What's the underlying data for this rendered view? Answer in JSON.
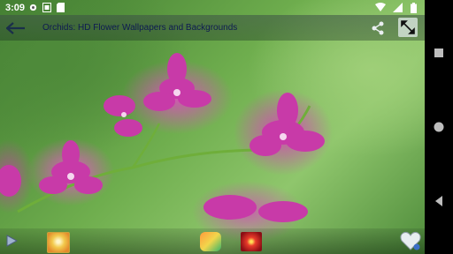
{
  "status_bar": {
    "time": "3:09",
    "left_icons": [
      "gear-icon",
      "photo-icon",
      "sd-card-icon"
    ],
    "right_icons": [
      "wifi-icon",
      "signal-icon",
      "battery-icon"
    ]
  },
  "app_bar": {
    "title": "Orchids: HD Flower Wallpapers and Backgrounds",
    "title_color": "#0e1a52",
    "actions": [
      "share-icon",
      "fullscreen-icon"
    ]
  },
  "wallpaper": {
    "subject": "pink orchids",
    "accent": "#d63fb8",
    "background": "#6fae4e"
  },
  "bottom_bar": {
    "actions": [
      "play-icon",
      "thumbnail-1",
      "thumbnail-2",
      "thumbnail-3",
      "favorite-icon"
    ]
  },
  "nav_bar": {
    "buttons": [
      "recents-icon",
      "home-icon",
      "back-icon"
    ]
  }
}
